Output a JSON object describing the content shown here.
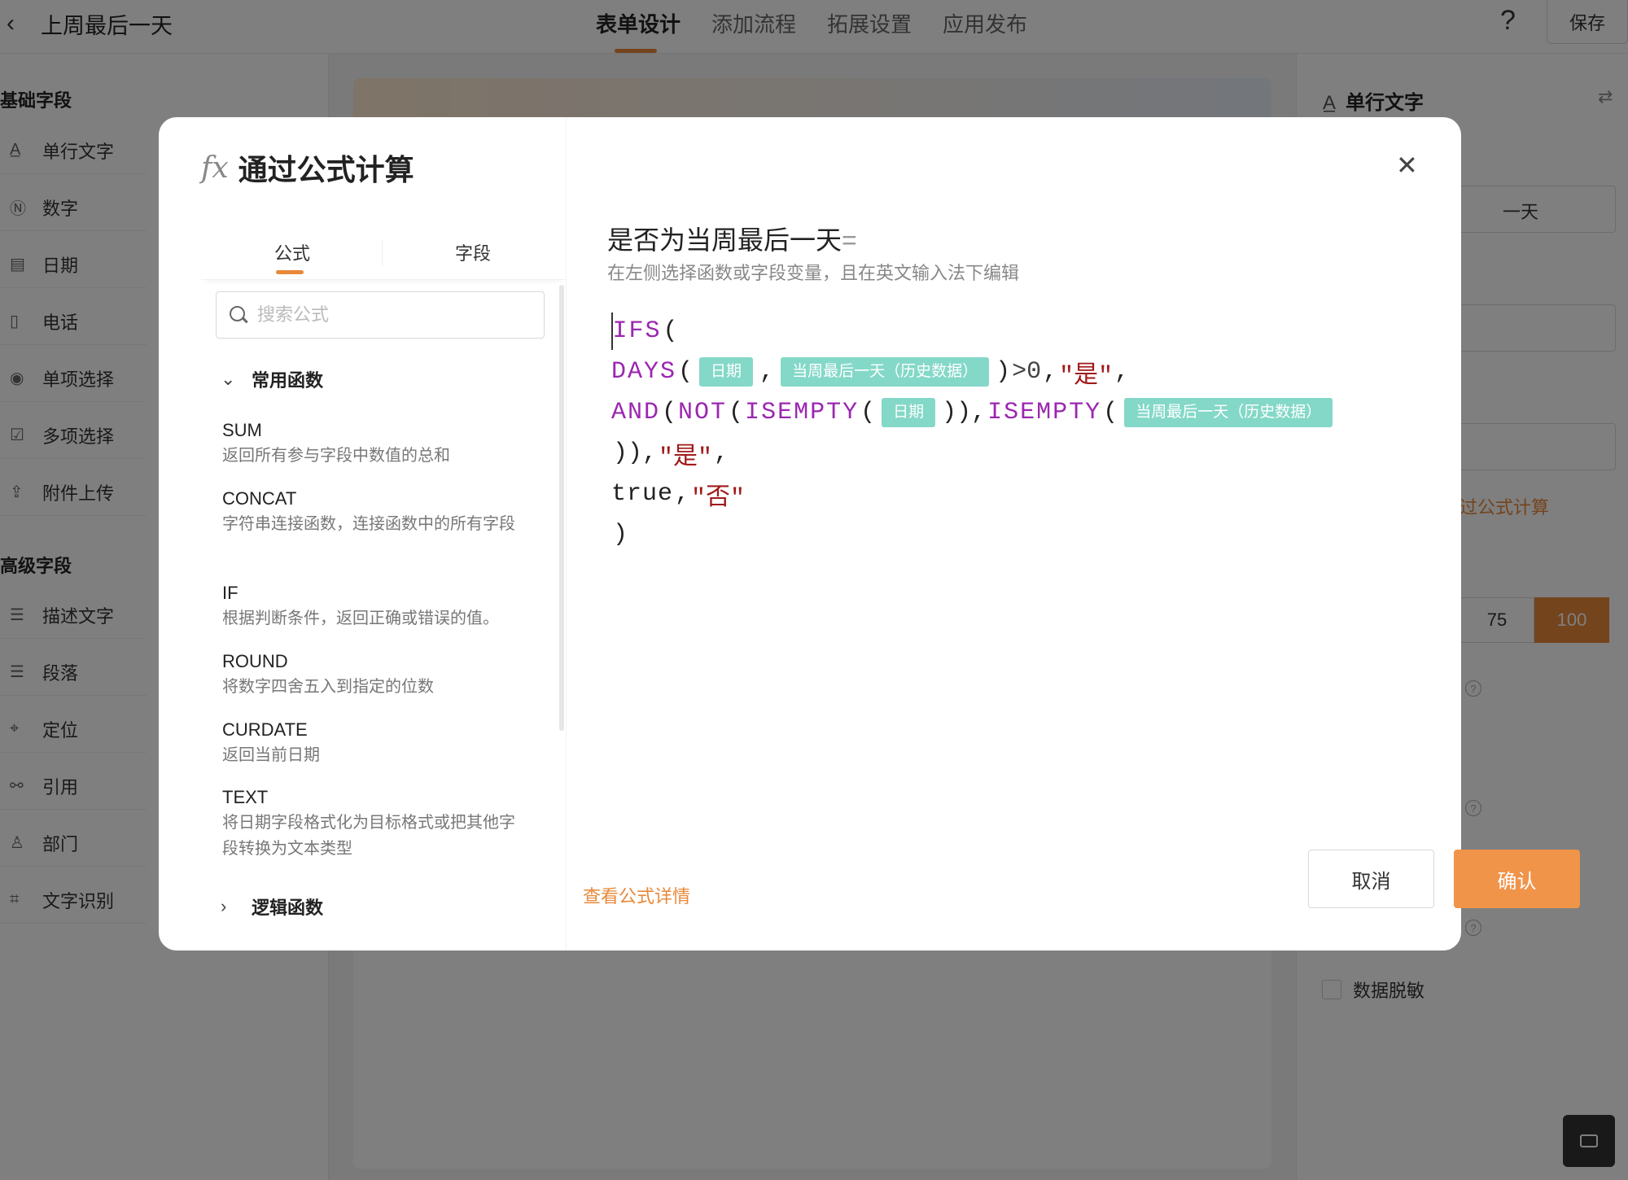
{
  "app": {
    "back_icon": "chevron-left-icon",
    "title": "上周最后一天",
    "tabs": [
      "表单设计",
      "添加流程",
      "拓展设置",
      "应用发布"
    ],
    "help": "?",
    "save_label": "保存"
  },
  "sidebar": {
    "basic_title": "基础字段",
    "basic_items": [
      {
        "icon": "A̲",
        "label": "单行文字"
      },
      {
        "icon": "Ⓝ",
        "label": "数字"
      },
      {
        "icon": "▤",
        "label": "日期"
      },
      {
        "icon": "▯",
        "label": "电话"
      },
      {
        "icon": "◉",
        "label": "单项选择"
      },
      {
        "icon": "☑",
        "label": "多项选择"
      },
      {
        "icon": "⇪",
        "label": "附件上传"
      }
    ],
    "advanced_title": "高级字段",
    "advanced_items": [
      {
        "icon": "☰",
        "label": "描述文字"
      },
      {
        "icon": "☰",
        "label": "段落"
      },
      {
        "icon": "⌖",
        "label": "定位"
      },
      {
        "icon": "⚯",
        "label": "引用"
      },
      {
        "icon": "♙",
        "label": "部门"
      },
      {
        "icon": "⌗",
        "label": "文字识别"
      }
    ]
  },
  "props": {
    "title": "单行文字",
    "title_icon": "A̲",
    "swap_icon": "⇄",
    "field_value": "一天",
    "link": "过公式计算",
    "widths": [
      "75",
      "100"
    ],
    "selected_width": "100",
    "mask_label": "数据脱敏"
  },
  "modal": {
    "fx_icon": "fx",
    "title": "通过公式计算",
    "close_icon": "✕",
    "tabs": [
      "公式",
      "字段"
    ],
    "search_placeholder": "搜索公式",
    "group_common": "常用函数",
    "group_logic": "逻辑函数",
    "functions": [
      {
        "name": "SUM",
        "desc": "返回所有参与字段中数值的总和"
      },
      {
        "name": "CONCAT",
        "desc": "字符串连接函数，连接函数中的所有字段"
      },
      {
        "name": "IF",
        "desc": "根据判断条件，返回正确或错误的值。"
      },
      {
        "name": "ROUND",
        "desc": "将数字四舍五入到指定的位数"
      },
      {
        "name": "CURDATE",
        "desc": "返回当前日期"
      },
      {
        "name": "TEXT",
        "desc": "将日期字段格式化为目标格式或把其他字段转换为文本类型"
      }
    ],
    "formula_title": "是否为当周最后一天",
    "formula_eq": "=",
    "formula_hint": "在左侧选择函数或字段变量，且在英文输入法下编辑",
    "code": {
      "ifs": "IFS",
      "days": "DAYS",
      "and": "AND",
      "not": "NOT",
      "isempty": "ISEMPTY",
      "field_date": "日期",
      "field_last_day": "当周最后一天（历史数据）",
      "gt_zero": ">0",
      "yes": "\"是\"",
      "no": "\"否\"",
      "true": "true"
    },
    "detail_link": "查看公式详情",
    "cancel": "取消",
    "confirm": "确认"
  },
  "colors": {
    "accent": "#e8893a",
    "keyword": "#9b27b0",
    "string": "#a11a1a",
    "field_tag": "#84d8c8"
  }
}
